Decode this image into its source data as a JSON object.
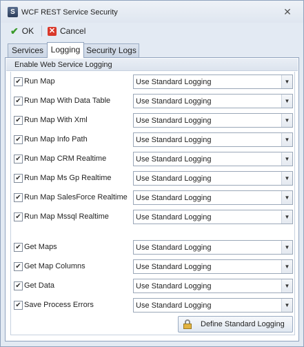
{
  "window": {
    "title": "WCF REST Service Security"
  },
  "toolbar": {
    "ok_label": "OK",
    "cancel_label": "Cancel"
  },
  "tabs": [
    {
      "label": "Services",
      "selected": false
    },
    {
      "label": "Logging",
      "selected": true
    },
    {
      "label": "Security Logs",
      "selected": false
    }
  ],
  "group": {
    "title": "Enable Web Service Logging"
  },
  "rows": [
    {
      "label": "Run Map",
      "checked": true,
      "value": "Use Standard Logging"
    },
    {
      "label": "Run Map With Data Table",
      "checked": true,
      "value": "Use Standard Logging"
    },
    {
      "label": "Run Map With Xml",
      "checked": true,
      "value": "Use Standard Logging"
    },
    {
      "label": "Run Map Info Path",
      "checked": true,
      "value": "Use Standard Logging"
    },
    {
      "label": "Run Map CRM Realtime",
      "checked": true,
      "value": "Use Standard Logging"
    },
    {
      "label": "Run Map Ms Gp Realtime",
      "checked": true,
      "value": "Use Standard Logging"
    },
    {
      "label": "Run Map SalesForce Realtime",
      "checked": true,
      "value": "Use Standard Logging"
    },
    {
      "label": "Run Map Mssql Realtime",
      "checked": true,
      "value": "Use Standard Logging"
    },
    {
      "label": "Get Maps",
      "checked": true,
      "value": "Use Standard Logging"
    },
    {
      "label": "Get Map Columns",
      "checked": true,
      "value": "Use Standard Logging"
    },
    {
      "label": "Get Data",
      "checked": true,
      "value": "Use Standard Logging"
    },
    {
      "label": "Save Process Errors",
      "checked": true,
      "value": "Use Standard Logging"
    }
  ],
  "define_button": {
    "label": "Define Standard Logging"
  },
  "icons": {
    "app": "app-icon",
    "close": "close-icon",
    "ok": "checkmark-icon",
    "cancel": "cancel-icon",
    "lock": "lock-icon",
    "dropdown": "chevron-down-icon"
  },
  "colors": {
    "ok_icon": "#3a9a2a",
    "cancel_icon": "#d9392b",
    "panel_border": "#8fa2bd"
  }
}
